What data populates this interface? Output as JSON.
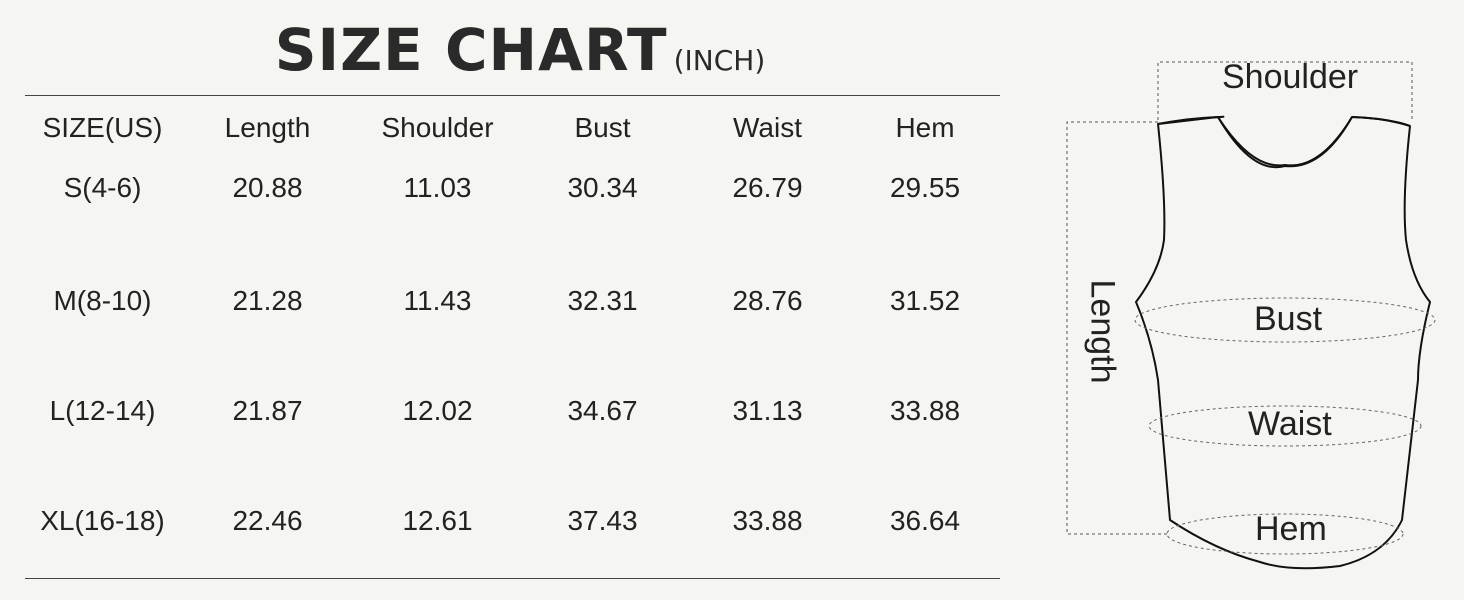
{
  "title": {
    "main": "SIZE CHART",
    "unit": "(INCH)"
  },
  "table": {
    "headers": [
      "SIZE(US)",
      "Length",
      "Shoulder",
      "Bust",
      "Waist",
      "Hem"
    ],
    "rows": [
      [
        "S(4-6)",
        "20.88",
        "11.03",
        "30.34",
        "26.79",
        "29.55"
      ],
      [
        "M(8-10)",
        "21.28",
        "11.43",
        "32.31",
        "28.76",
        "31.52"
      ],
      [
        "L(12-14)",
        "21.87",
        "12.02",
        "34.67",
        "31.13",
        "33.88"
      ],
      [
        "XL(16-18)",
        "22.46",
        "12.61",
        "37.43",
        "33.88",
        "36.64"
      ]
    ]
  },
  "diagram": {
    "shoulder": "Shoulder",
    "length": "Length",
    "bust": "Bust",
    "waist": "Waist",
    "hem": "Hem"
  }
}
